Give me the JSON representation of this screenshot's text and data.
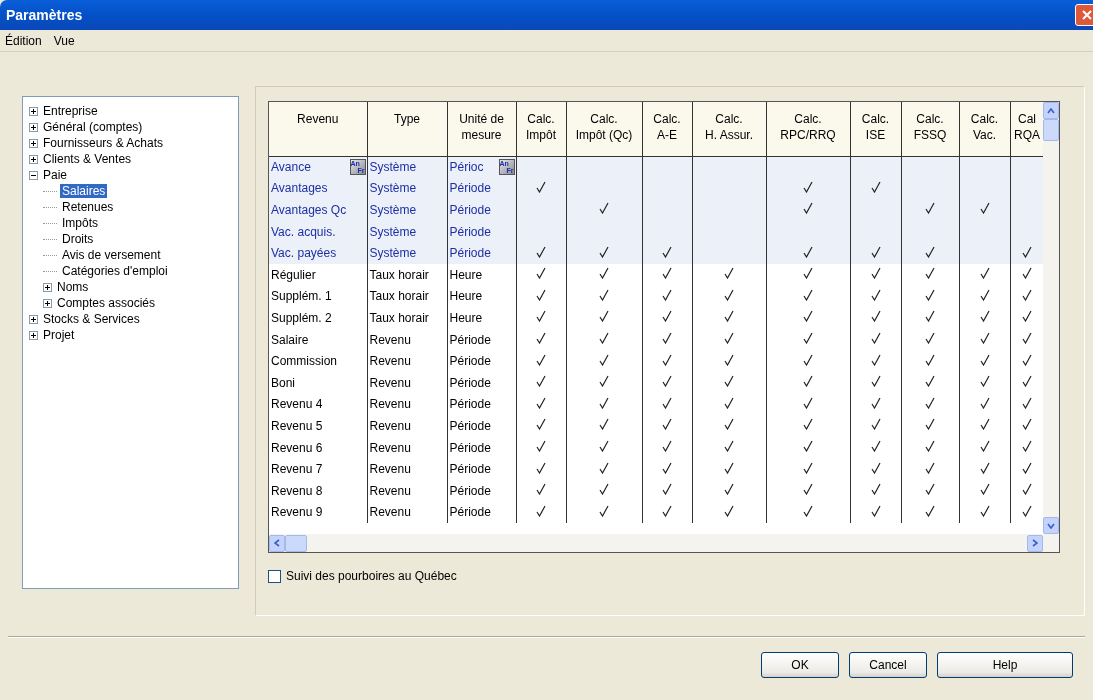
{
  "window": {
    "title": "Paramètres"
  },
  "menu": [
    "Édition",
    "Vue"
  ],
  "tree": [
    {
      "label": "Entreprise",
      "expanded": false,
      "selected": false
    },
    {
      "label": "Général (comptes)",
      "expanded": false,
      "selected": false
    },
    {
      "label": "Fournisseurs & Achats",
      "expanded": false,
      "selected": false
    },
    {
      "label": "Clients & Ventes",
      "expanded": false,
      "selected": false
    },
    {
      "label": "Paie",
      "expanded": true,
      "selected": false,
      "children": [
        {
          "label": "Salaires",
          "selected": true
        },
        {
          "label": "Retenues",
          "selected": false
        },
        {
          "label": "Impôts",
          "selected": false
        },
        {
          "label": "Droits",
          "selected": false
        },
        {
          "label": "Avis de versement",
          "selected": false
        },
        {
          "label": "Catégories d'emploi",
          "selected": false
        },
        {
          "label": "Noms",
          "expanded": false,
          "selected": false
        },
        {
          "label": "Comptes associés",
          "expanded": false,
          "selected": false
        }
      ]
    },
    {
      "label": "Stocks & Services",
      "expanded": false,
      "selected": false
    },
    {
      "label": "Projet",
      "expanded": false,
      "selected": false
    }
  ],
  "table": {
    "columns": [
      "Revenu",
      "Type",
      "Unité de\nmesure",
      "Calc.\nImpôt",
      "Calc.\nImpôt (Qc)",
      "Calc.\nA-E",
      "Calc.\nH. Assur.",
      "Calc.\nRPC/RRQ",
      "Calc.\nISE",
      "Calc.\nFSSQ",
      "Calc.\nVac.",
      "Cal\nRQA"
    ],
    "rows": [
      {
        "kind": "system",
        "cells": [
          {
            "text": "Avance",
            "badge": [
              "An",
              "Fr"
            ]
          },
          "Système",
          {
            "text": "Périoc",
            "badge": [
              "An",
              "Fr"
            ]
          }
        ],
        "checks": [
          false,
          false,
          false,
          false,
          false,
          false,
          false,
          false,
          false
        ]
      },
      {
        "kind": "system",
        "cells": [
          "Avantages",
          "Système",
          "Période"
        ],
        "checks": [
          true,
          false,
          false,
          false,
          true,
          true,
          false,
          false,
          false
        ]
      },
      {
        "kind": "system",
        "cells": [
          "Avantages Qc",
          "Système",
          "Période"
        ],
        "checks": [
          false,
          true,
          false,
          false,
          true,
          false,
          true,
          true,
          false
        ]
      },
      {
        "kind": "system",
        "cells": [
          "Vac. acquis.",
          "Système",
          "Période"
        ],
        "checks": [
          false,
          false,
          false,
          false,
          false,
          false,
          false,
          false,
          false
        ]
      },
      {
        "kind": "system",
        "cells": [
          "Vac. payées",
          "Système",
          "Période"
        ],
        "checks": [
          true,
          true,
          true,
          false,
          true,
          true,
          true,
          false,
          true
        ]
      },
      {
        "kind": "user",
        "cells": [
          "Régulier",
          "Taux horair",
          "Heure"
        ],
        "checks": [
          true,
          true,
          true,
          true,
          true,
          true,
          true,
          true,
          true
        ]
      },
      {
        "kind": "user",
        "cells": [
          "Supplém. 1",
          "Taux horair",
          "Heure"
        ],
        "checks": [
          true,
          true,
          true,
          true,
          true,
          true,
          true,
          true,
          true
        ]
      },
      {
        "kind": "user",
        "cells": [
          "Supplém. 2",
          "Taux horair",
          "Heure"
        ],
        "checks": [
          true,
          true,
          true,
          true,
          true,
          true,
          true,
          true,
          true
        ]
      },
      {
        "kind": "user",
        "cells": [
          "Salaire",
          "Revenu",
          "Période"
        ],
        "checks": [
          true,
          true,
          true,
          true,
          true,
          true,
          true,
          true,
          true
        ]
      },
      {
        "kind": "user",
        "cells": [
          "Commission",
          "Revenu",
          "Période"
        ],
        "checks": [
          true,
          true,
          true,
          true,
          true,
          true,
          true,
          true,
          true
        ]
      },
      {
        "kind": "user",
        "cells": [
          "Boni",
          "Revenu",
          "Période"
        ],
        "checks": [
          true,
          true,
          true,
          true,
          true,
          true,
          true,
          true,
          true
        ]
      },
      {
        "kind": "user",
        "cells": [
          "Revenu 4",
          "Revenu",
          "Période"
        ],
        "checks": [
          true,
          true,
          true,
          true,
          true,
          true,
          true,
          true,
          true
        ]
      },
      {
        "kind": "user",
        "cells": [
          "Revenu 5",
          "Revenu",
          "Période"
        ],
        "checks": [
          true,
          true,
          true,
          true,
          true,
          true,
          true,
          true,
          true
        ]
      },
      {
        "kind": "user",
        "cells": [
          "Revenu 6",
          "Revenu",
          "Période"
        ],
        "checks": [
          true,
          true,
          true,
          true,
          true,
          true,
          true,
          true,
          true
        ]
      },
      {
        "kind": "user",
        "cells": [
          "Revenu 7",
          "Revenu",
          "Période"
        ],
        "checks": [
          true,
          true,
          true,
          true,
          true,
          true,
          true,
          true,
          true
        ]
      },
      {
        "kind": "user",
        "cells": [
          "Revenu 8",
          "Revenu",
          "Période"
        ],
        "checks": [
          true,
          true,
          true,
          true,
          true,
          true,
          true,
          true,
          true
        ]
      },
      {
        "kind": "user",
        "cells": [
          "Revenu 9",
          "Revenu",
          "Période"
        ],
        "checks": [
          true,
          true,
          true,
          true,
          true,
          true,
          true,
          true,
          true
        ]
      }
    ]
  },
  "tips_checkbox": {
    "label": "Suivi des pourboires au Québec",
    "checked": false
  },
  "buttons": [
    "OK",
    "Cancel",
    "Help"
  ]
}
